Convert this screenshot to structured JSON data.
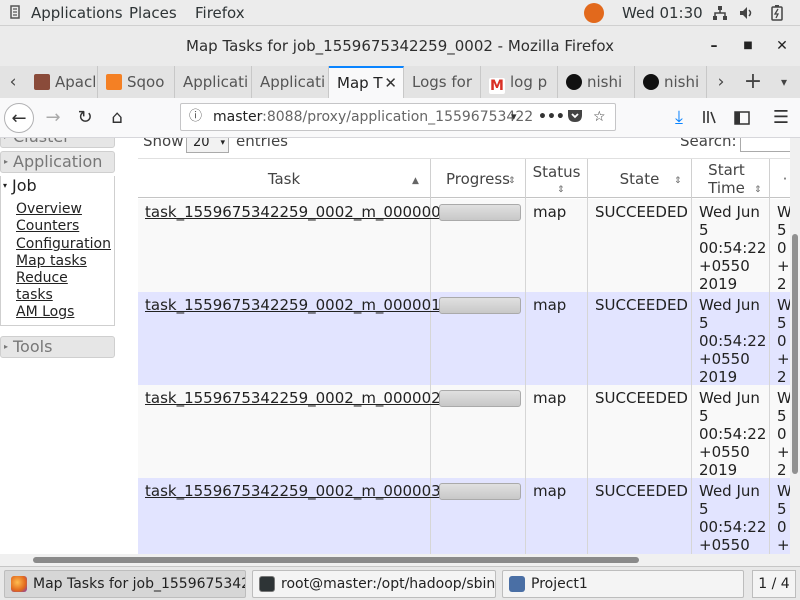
{
  "topbar": {
    "applications": "Applications",
    "places": "Places",
    "firefox": "Firefox",
    "clock": "Wed 01:30"
  },
  "window": {
    "title": "Map Tasks for job_1559675342259_0002 - Mozilla Firefox"
  },
  "tabs": [
    {
      "label": "Apacl",
      "icon": "person-avatar-icon"
    },
    {
      "label": "Sqoo",
      "icon": "stackoverflow-icon"
    },
    {
      "label": "Applicati",
      "icon": "none"
    },
    {
      "label": "Applicati",
      "icon": "none"
    },
    {
      "label": "Map T",
      "icon": "none",
      "active": true
    },
    {
      "label": "Logs for",
      "icon": "none"
    },
    {
      "label": "log p",
      "icon": "gmail-icon"
    },
    {
      "label": "nishi",
      "icon": "github-icon"
    },
    {
      "label": "nishi",
      "icon": "github-icon"
    }
  ],
  "navbar": {
    "url_host": "master",
    "url_rest": ":8088/proxy/application_15596753422"
  },
  "sidebar": {
    "cluster": "Cluster",
    "application": "Application",
    "job": "Job",
    "links": [
      "Overview",
      "Counters",
      "Configuration",
      "Map tasks",
      "Reduce",
      "tasks",
      "AM Logs"
    ],
    "tools": "Tools"
  },
  "controls": {
    "show_label": "Show",
    "show_value": "20",
    "entries_label": "entries",
    "search_label": "Search:"
  },
  "table": {
    "headers": [
      "Task",
      "Progress",
      "Status",
      "State",
      "Start Time"
    ],
    "rows": [
      {
        "task": "task_1559675342259_0002_m_000000",
        "progress": 100,
        "status": "map",
        "state": "SUCCEEDED",
        "start": [
          "Wed Jun",
          "5",
          "00:54:22",
          "+0550",
          "2019"
        ],
        "next": [
          "W",
          "5",
          "0",
          "+",
          "2"
        ]
      },
      {
        "task": "task_1559675342259_0002_m_000001",
        "progress": 100,
        "status": "map",
        "state": "SUCCEEDED",
        "start": [
          "Wed Jun",
          "5",
          "00:54:22",
          "+0550",
          "2019"
        ],
        "next": [
          "W",
          "5",
          "0",
          "+",
          "2"
        ]
      },
      {
        "task": "task_1559675342259_0002_m_000002",
        "progress": 100,
        "status": "map",
        "state": "SUCCEEDED",
        "start": [
          "Wed Jun",
          "5",
          "00:54:22",
          "+0550",
          "2019"
        ],
        "next": [
          "W",
          "5",
          "0",
          "+",
          "2"
        ]
      },
      {
        "task": "task_1559675342259_0002_m_000003",
        "progress": 100,
        "status": "map",
        "state": "SUCCEEDED",
        "start": [
          "Wed Jun",
          "5",
          "00:54:22",
          "+0550"
        ],
        "next": [
          "W",
          "5",
          "0",
          "+"
        ]
      }
    ]
  },
  "taskbar": {
    "items": [
      {
        "label": "Map Tasks for job_1559675342...",
        "icon": "firefox-icon"
      },
      {
        "label": "root@master:/opt/hadoop/sbin",
        "icon": "terminal-icon"
      },
      {
        "label": "Project1",
        "icon": "project-icon"
      }
    ],
    "workspace": "1 / 4"
  },
  "colors": {
    "row_even": "#e2e4ff",
    "row_odd": "#f9f9f9",
    "accent": "#0a84ff"
  }
}
